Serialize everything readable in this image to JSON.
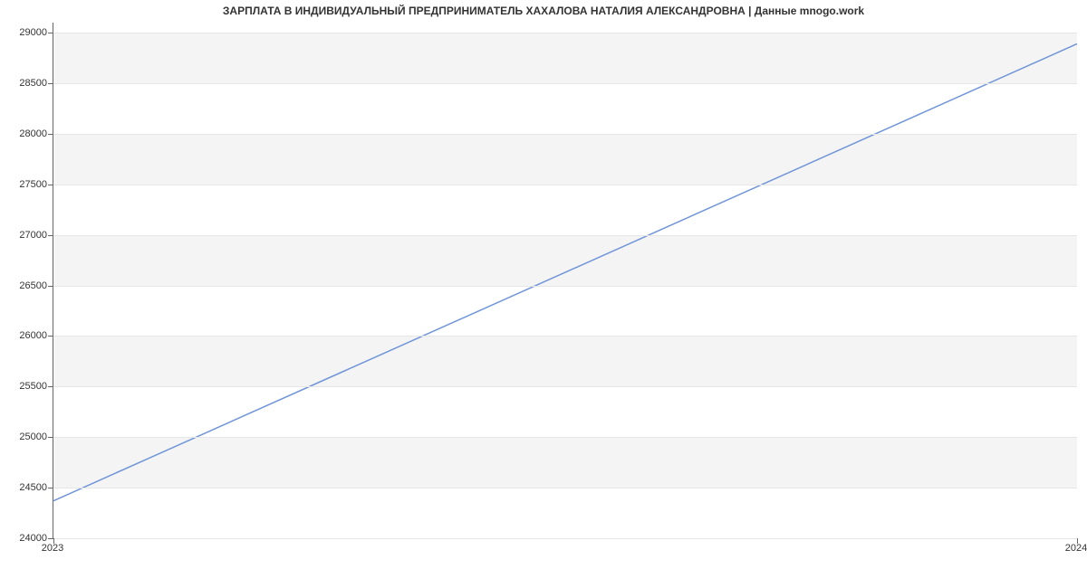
{
  "chart_data": {
    "type": "line",
    "title": "ЗАРПЛАТА В ИНДИВИДУАЛЬНЫЙ ПРЕДПРИНИМАТЕЛЬ ХАХАЛОВА НАТАЛИЯ АЛЕКСАНДРОВНА | Данные mnogo.work",
    "xlabel": "",
    "ylabel": "",
    "x": [
      2023,
      2024
    ],
    "values": [
      24370,
      28890
    ],
    "y_ticks": [
      24000,
      24500,
      25000,
      25500,
      26000,
      26500,
      27000,
      27500,
      28000,
      28500,
      29000
    ],
    "x_ticks": [
      2023,
      2024
    ],
    "ylim": [
      24000,
      29100
    ],
    "xlim": [
      2023,
      2024
    ],
    "line_color": "#6f95d8"
  }
}
